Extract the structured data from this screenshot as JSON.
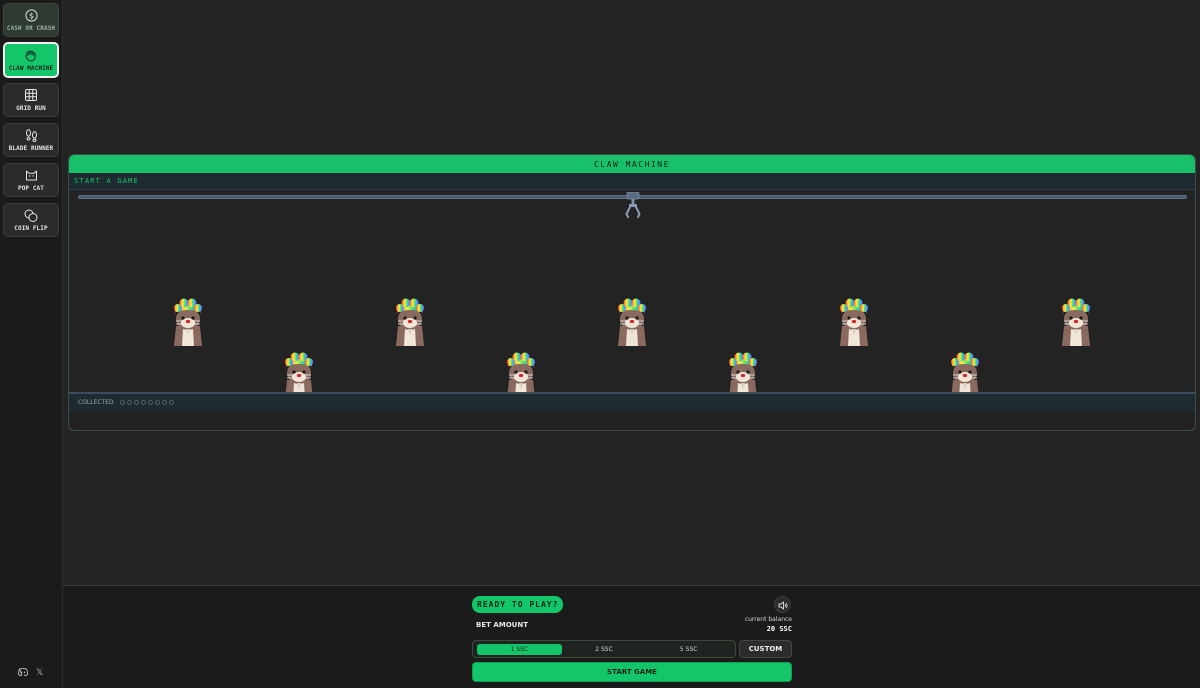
{
  "sidebar": {
    "items": [
      {
        "label": "CASH OR CRASH",
        "icon": "dollar-icon"
      },
      {
        "label": "CLAW MACHINE",
        "icon": "claw-hand-icon"
      },
      {
        "label": "GRID RUN",
        "icon": "grid-icon"
      },
      {
        "label": "BLADE RUNNER",
        "icon": "footprints-icon"
      },
      {
        "label": "POP CAT",
        "icon": "cat-icon"
      },
      {
        "label": "COIN FLIP",
        "icon": "coins-icon"
      }
    ],
    "active_index": 1,
    "social": {
      "discord": "discord-icon",
      "x_label": "𝕏"
    }
  },
  "game": {
    "title": "CLAW MACHINE",
    "status": "START A GAME",
    "collected_label": "COLLECTED",
    "prize_count": 9,
    "prize_icon": "rainbow-hair-otter"
  },
  "controls": {
    "ready": "READY TO PLAY?",
    "bet_label": "BET AMOUNT",
    "balance_label": "current balance",
    "balance_value": "20 SSC",
    "bet_options": [
      "1 SSC",
      "2 SSC",
      "5 SSC"
    ],
    "selected_bet": "1 SSC",
    "custom_label": "CUSTOM",
    "start_label": "START GAME",
    "sound_icon": "speaker-icon"
  },
  "colors": {
    "accent": "#13c66a",
    "background": "#242424",
    "sidebar": "#1b1b1b"
  }
}
